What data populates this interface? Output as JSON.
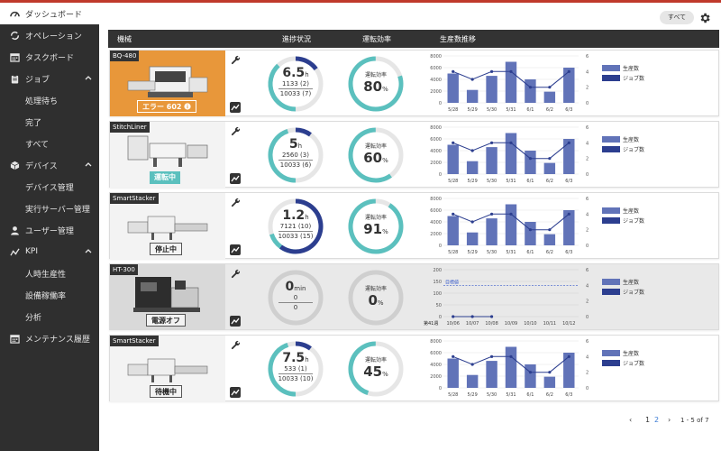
{
  "sidebar": {
    "items": [
      {
        "label": "ダッシュボード",
        "icon": "gauge-icon",
        "active": true,
        "sub": false
      },
      {
        "label": "オペレーション",
        "icon": "sync-icon",
        "sub": false
      },
      {
        "label": "タスクボード",
        "icon": "calendar-icon",
        "sub": false
      },
      {
        "label": "ジョブ",
        "icon": "clipboard-icon",
        "sub": false,
        "expanded": true
      },
      {
        "label": "処理待ち",
        "sub": true
      },
      {
        "label": "完了",
        "sub": true
      },
      {
        "label": "すべて",
        "sub": true
      },
      {
        "label": "デバイス",
        "icon": "cube-icon",
        "sub": false,
        "expanded": true
      },
      {
        "label": "デバイス管理",
        "sub": true
      },
      {
        "label": "実行サーバー管理",
        "sub": true
      },
      {
        "label": "ユーザー管理",
        "icon": "user-icon",
        "sub": false
      },
      {
        "label": "KPI",
        "icon": "kpi-icon",
        "sub": false,
        "expanded": true
      },
      {
        "label": "人時生産性",
        "sub": true
      },
      {
        "label": "設備稼働率",
        "sub": true
      },
      {
        "label": "分析",
        "sub": true
      },
      {
        "label": "メンテナンス履歴",
        "icon": "calendar-icon",
        "sub": false
      }
    ]
  },
  "toolbar": {
    "filter_label": "すべて"
  },
  "table": {
    "headers": {
      "device": "機械",
      "progress": "進捗状況",
      "efficiency": "運転効率",
      "trend": "生産数推移"
    }
  },
  "colors": {
    "accent": "#5bc0be",
    "navy": "#2c3e8f",
    "bar": "#6173b8",
    "error": "#e8973a"
  },
  "rows": [
    {
      "name": "BQ-480",
      "status": "エラー 602",
      "status_kind": "err",
      "progress_value": "6.5",
      "progress_unit": "h",
      "progress_line1": "1133 (2)",
      "progress_line2": "10033 (7)",
      "progress_teal_fraction": 0.38,
      "progress_navy_fraction": 0.15,
      "efficiency_label": "運転効率",
      "efficiency_value": "80",
      "efficiency_unit": "%",
      "efficiency_fraction": 0.8,
      "chart_kind": "bars"
    },
    {
      "name": "StitchLiner",
      "status": "運転中",
      "status_kind": "run",
      "progress_value": "5",
      "progress_unit": "h",
      "progress_line1": "2560 (3)",
      "progress_line2": "10033 (6)",
      "progress_teal_fraction": 0.45,
      "progress_navy_fraction": 0.1,
      "efficiency_label": "運転効率",
      "efficiency_value": "60",
      "efficiency_unit": "%",
      "efficiency_fraction": 0.6,
      "chart_kind": "bars"
    },
    {
      "name": "SmartStacker",
      "status": "停止中",
      "status_kind": "stop",
      "progress_value": "1.2",
      "progress_unit": "h",
      "progress_line1": "7121 (10)",
      "progress_line2": "10033 (15)",
      "progress_teal_fraction": 0.2,
      "progress_navy_fraction": 0.6,
      "efficiency_label": "運転効率",
      "efficiency_value": "91",
      "efficiency_unit": "%",
      "efficiency_fraction": 0.91,
      "chart_kind": "bars"
    },
    {
      "name": "HT-300",
      "status": "電源オフ",
      "status_kind": "off",
      "progress_value": "0",
      "progress_unit": "min",
      "progress_line1": "0",
      "progress_line2": "0",
      "progress_teal_fraction": 0,
      "progress_navy_fraction": 0,
      "efficiency_label": "運転効率",
      "efficiency_value": "0",
      "efficiency_unit": "%",
      "efficiency_fraction": 0,
      "chart_kind": "weekly"
    },
    {
      "name": "SmartStacker",
      "status": "待機中",
      "status_kind": "wait",
      "progress_value": "7.5",
      "progress_unit": "h",
      "progress_line1": "533 (1)",
      "progress_line2": "10033 (10)",
      "progress_teal_fraction": 0.45,
      "progress_navy_fraction": 0.1,
      "efficiency_label": "運転効率",
      "efficiency_value": "45",
      "efficiency_unit": "%",
      "efficiency_fraction": 0.45,
      "chart_kind": "bars"
    }
  ],
  "chart_data": [
    {
      "type": "bar",
      "categories": [
        "5/28",
        "5/29",
        "5/30",
        "5/31",
        "6/1",
        "6/2",
        "6/3"
      ],
      "y_ticks_left": [
        "8000",
        "6000",
        "4000",
        "2000",
        "0"
      ],
      "y_ticks_right": [
        "6",
        "4",
        "2",
        "0"
      ],
      "ylim": [
        0,
        8000
      ],
      "y2lim": [
        0,
        6
      ],
      "series": [
        {
          "name": "生産数",
          "kind": "bar",
          "values": [
            5000,
            2200,
            4600,
            7000,
            4000,
            1900,
            6000
          ]
        },
        {
          "name": "ジョブ数",
          "kind": "line",
          "values": [
            4,
            3,
            4,
            4,
            2,
            2,
            4
          ]
        }
      ]
    },
    {
      "type": "line",
      "categories": [
        "10/06",
        "10/07",
        "10/08",
        "10/09",
        "10/10",
        "10/11",
        "10/12"
      ],
      "y_ticks_left": [
        "200",
        "150",
        "100",
        "50",
        "0"
      ],
      "y_ticks_right": [
        "6",
        "4",
        "2",
        "0"
      ],
      "ylim": [
        0,
        200
      ],
      "y2lim": [
        0,
        6
      ],
      "target_label": "目標値",
      "target_value": 4,
      "week_label": "第41週",
      "series": [
        {
          "name": "生産数",
          "kind": "bar",
          "values": [
            0,
            0,
            0,
            0,
            0,
            0,
            0
          ]
        },
        {
          "name": "ジョブ数",
          "kind": "line",
          "values": [
            0,
            0,
            0
          ]
        }
      ]
    }
  ],
  "pagination": {
    "prev": "‹",
    "page1": "1",
    "page2": "2",
    "next": "›",
    "range": "1 - 5 of 7"
  }
}
